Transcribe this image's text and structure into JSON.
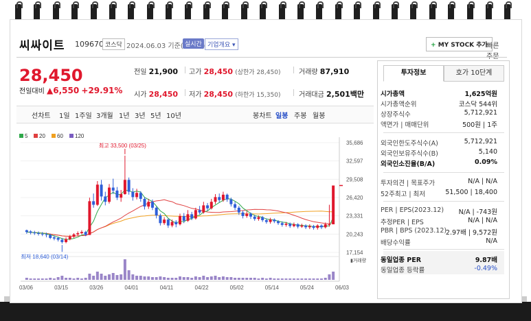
{
  "header": {
    "name": "씨싸이트",
    "code": "109670",
    "market": "코스닥",
    "date_text": "2024.06.03 기준(장마감)",
    "realtime": "실시간",
    "company_info": "기업개요",
    "mystock": "MY STOCK 추가",
    "quick_order": "빠른주문"
  },
  "price": {
    "current": "28,450",
    "change_label": "전일대비",
    "change_value": "6,550",
    "change_pct": "+29.91%"
  },
  "stats": {
    "prev_close_label": "전일",
    "prev_close": "21,900",
    "high_label": "고가",
    "high": "28,450",
    "high_sub": "(상한가 28,450)",
    "volume_label": "거래량",
    "volume": "87,910",
    "open_label": "시가",
    "open": "28,450",
    "low_label": "저가",
    "low": "28,450",
    "low_sub": "(하한가 15,350)",
    "amount_label": "거래대금",
    "amount": "2,501백만"
  },
  "periods": [
    "선차트",
    "1일",
    "1주일",
    "3개월",
    "1년",
    "3년",
    "5년",
    "10년"
  ],
  "chart_kinds": [
    "봉차트",
    "일봉",
    "주봉",
    "월봉"
  ],
  "active_kind": "일봉",
  "chart_data": {
    "type": "candlestick",
    "legend": [
      {
        "name": "5",
        "color": "#2fa84a"
      },
      {
        "name": "20",
        "color": "#e04040"
      },
      {
        "name": "60",
        "color": "#f0a020"
      },
      {
        "name": "120",
        "color": "#7a5cc0"
      }
    ],
    "y_ticks": [
      "35,686",
      "32,597",
      "29,508",
      "26,420",
      "23,331",
      "20,243",
      "17,154"
    ],
    "ylim": [
      17154,
      35686
    ],
    "x_ticks": [
      "03/06",
      "03/15",
      "03/26",
      "04/01",
      "04/11",
      "04/22",
      "05/02",
      "05/14",
      "05/24",
      "06/03"
    ],
    "high_annotation": "최고 33,500 (03/25)",
    "low_annotation": "최저 18,640 (03/14)",
    "volume_label": "거래량",
    "candles": [
      [
        20900,
        20600,
        21000,
        20300
      ],
      [
        20700,
        20500,
        20900,
        20200
      ],
      [
        20500,
        20400,
        20800,
        20100
      ],
      [
        20400,
        20300,
        20700,
        20000
      ],
      [
        20300,
        20200,
        20600,
        19900
      ],
      [
        20200,
        20100,
        20500,
        19700
      ],
      [
        20100,
        19600,
        20300,
        19400
      ],
      [
        19700,
        19500,
        20000,
        19200
      ],
      [
        19600,
        19300,
        19800,
        19000
      ],
      [
        19300,
        18900,
        19600,
        18640
      ],
      [
        18900,
        19400,
        19700,
        18700
      ],
      [
        19400,
        19800,
        20100,
        19200
      ],
      [
        19800,
        20200,
        20400,
        19600
      ],
      [
        20200,
        20400,
        20700,
        20000
      ],
      [
        20400,
        20600,
        20900,
        20200
      ],
      [
        20600,
        20100,
        20800,
        19900
      ],
      [
        20100,
        25800,
        26400,
        20100
      ],
      [
        25800,
        25200,
        27100,
        24700
      ],
      [
        25200,
        28600,
        29200,
        25000
      ],
      [
        28600,
        26600,
        29400,
        25900
      ],
      [
        26600,
        25700,
        27400,
        25100
      ],
      [
        25700,
        28100,
        28700,
        25400
      ],
      [
        28100,
        27600,
        29600,
        27000
      ],
      [
        27600,
        26400,
        28200,
        26000
      ],
      [
        26400,
        27000,
        27700,
        25700
      ],
      [
        27000,
        29400,
        33500,
        26900
      ],
      [
        29400,
        27400,
        29800,
        26900
      ],
      [
        27400,
        26500,
        28000,
        25900
      ],
      [
        26500,
        27200,
        27900,
        26100
      ],
      [
        27200,
        26200,
        27500,
        25700
      ],
      [
        26200,
        24900,
        26500,
        24400
      ],
      [
        24900,
        25700,
        26200,
        24500
      ],
      [
        25700,
        24700,
        26100,
        24300
      ],
      [
        24700,
        23400,
        24900,
        22900
      ],
      [
        23400,
        22100,
        23700,
        21700
      ],
      [
        22100,
        22700,
        23100,
        21800
      ],
      [
        22700,
        21700,
        22900,
        21300
      ],
      [
        21700,
        22300,
        22700,
        21400
      ],
      [
        22300,
        21900,
        22600,
        21400
      ],
      [
        21900,
        23300,
        23700,
        21700
      ],
      [
        23300,
        22500,
        23800,
        22100
      ],
      [
        22500,
        23600,
        24300,
        22300
      ],
      [
        23600,
        22900,
        24000,
        22600
      ],
      [
        22900,
        24300,
        24700,
        22700
      ],
      [
        24300,
        23900,
        25000,
        23600
      ],
      [
        23900,
        25100,
        25700,
        23700
      ],
      [
        25100,
        24600,
        25500,
        24200
      ],
      [
        24600,
        25700,
        26200,
        24400
      ],
      [
        25700,
        26500,
        27000,
        25300
      ],
      [
        26500,
        26000,
        27100,
        25600
      ],
      [
        26000,
        26900,
        27400,
        25700
      ],
      [
        26900,
        26100,
        27100,
        25700
      ],
      [
        26100,
        25300,
        26400,
        24900
      ],
      [
        25300,
        24700,
        25700,
        24300
      ],
      [
        24700,
        23900,
        25000,
        23500
      ],
      [
        23900,
        23300,
        24200,
        22900
      ],
      [
        23300,
        23700,
        24100,
        23000
      ],
      [
        23700,
        23200,
        23900,
        22800
      ],
      [
        23200,
        22800,
        23500,
        22500
      ],
      [
        22800,
        23100,
        23400,
        22500
      ],
      [
        23100,
        22600,
        23300,
        22300
      ],
      [
        22600,
        22300,
        22900,
        22000
      ],
      [
        22300,
        22700,
        23000,
        22000
      ],
      [
        22700,
        22400,
        22900,
        22100
      ],
      [
        22400,
        22100,
        22600,
        21800
      ],
      [
        22100,
        21800,
        22400,
        21500
      ],
      [
        21800,
        22000,
        22300,
        21500
      ],
      [
        22000,
        21600,
        22200,
        21300
      ],
      [
        21600,
        21900,
        22200,
        21400
      ],
      [
        21900,
        21500,
        22100,
        21200
      ],
      [
        21500,
        21700,
        22000,
        21300
      ],
      [
        21700,
        21400,
        21900,
        21100
      ],
      [
        21400,
        21600,
        21900,
        21100
      ],
      [
        21600,
        21300,
        21800,
        21000
      ],
      [
        21300,
        21700,
        21900,
        21000
      ],
      [
        21700,
        21400,
        21900,
        21100
      ],
      [
        21400,
        21900,
        22200,
        21200
      ],
      [
        21900,
        21900,
        25200,
        21500
      ],
      [
        21900,
        28450,
        28450,
        21900
      ]
    ],
    "volumes": [
      3,
      2,
      2,
      2,
      2,
      2,
      3,
      2,
      4,
      6,
      3,
      3,
      2,
      3,
      2,
      3,
      9,
      6,
      12,
      9,
      6,
      8,
      10,
      7,
      8,
      30,
      14,
      8,
      6,
      6,
      5,
      5,
      4,
      4,
      5,
      4,
      3,
      3,
      3,
      5,
      4,
      4,
      3,
      5,
      4,
      6,
      4,
      5,
      6,
      4,
      5,
      4,
      4,
      3,
      3,
      3,
      3,
      3,
      3,
      2,
      3,
      2,
      3,
      2,
      2,
      2,
      2,
      2,
      2,
      2,
      2,
      2,
      2,
      2,
      2,
      2,
      3,
      8,
      12
    ],
    "ma5_color": "#2fa84a",
    "ma20_color": "#e04040",
    "ma60_color": "#f0a020",
    "up_color": "#e0182d",
    "down_color": "#2f5fd8"
  },
  "right_panel": {
    "tab_invest": "투자정보",
    "tab_hoga": "호가 10단계",
    "rows1": [
      {
        "l": "시가총액",
        "r": "1,625억원",
        "bold": true
      },
      {
        "l": "시가총액순위",
        "r": "코스닥 544위"
      },
      {
        "l": "상장주식수",
        "r": "5,712,921"
      },
      {
        "l": "액면가 | 매매단위",
        "r": "500원 | 1주"
      }
    ],
    "rows2": [
      {
        "l": "외국인한도주식수(A)",
        "r": "5,712,921"
      },
      {
        "l": "외국인보유주식수(B)",
        "r": "5,140"
      },
      {
        "l": "외국인소진율(B/A)",
        "r": "0.09%",
        "bold": true
      }
    ],
    "rows3": [
      {
        "l": "투자의견 | 목표주가",
        "r": "N/A | N/A"
      },
      {
        "l": "52주최고 | 최저",
        "r": "51,500 | 18,400"
      }
    ],
    "rows4": [
      {
        "l": "PER | EPS(2023.12)",
        "r": "N/A | -743원"
      },
      {
        "l": "추정PER | EPS",
        "r": "N/A | N/A"
      },
      {
        "l": "PBR | BPS (2023.12)",
        "r": "2.97배 | 9,572원"
      },
      {
        "l": "배당수익률",
        "r": "N/A"
      }
    ],
    "rows5": [
      {
        "l": "동일업종 PER",
        "r": "9.87배",
        "bold": true
      },
      {
        "l": "동일업종 등락률",
        "r": "-0.49%",
        "blue": true
      }
    ]
  }
}
